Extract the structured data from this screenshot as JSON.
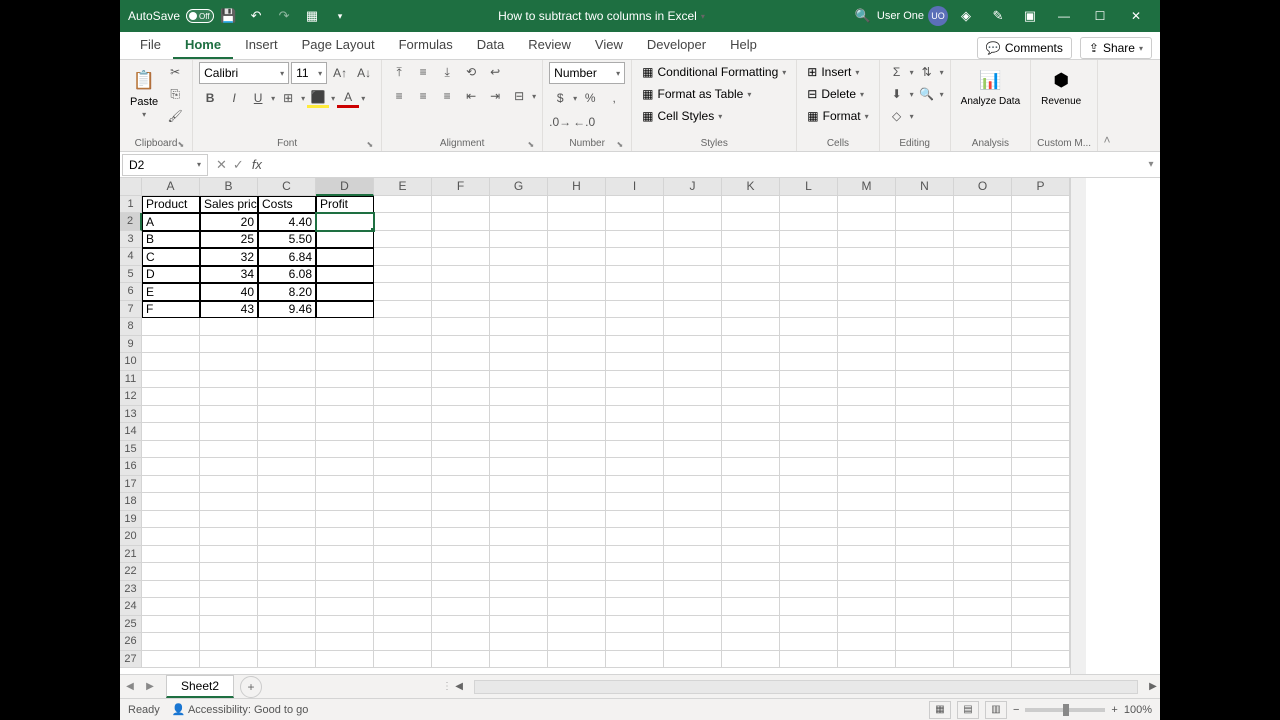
{
  "titlebar": {
    "autosave_label": "AutoSave",
    "autosave_state": "Off",
    "doc_title": "How to subtract two columns in Excel",
    "user_name": "User One",
    "user_initials": "UO"
  },
  "tabs": [
    "File",
    "Home",
    "Insert",
    "Page Layout",
    "Formulas",
    "Data",
    "Review",
    "View",
    "Developer",
    "Help"
  ],
  "active_tab": "Home",
  "ribbon_right": {
    "comments": "Comments",
    "share": "Share"
  },
  "ribbon": {
    "clipboard": {
      "paste": "Paste",
      "label": "Clipboard"
    },
    "font": {
      "name": "Calibri",
      "size": "11",
      "label": "Font"
    },
    "alignment": {
      "label": "Alignment"
    },
    "number": {
      "format": "Number",
      "label": "Number"
    },
    "styles": {
      "conditional": "Conditional Formatting",
      "table": "Format as Table",
      "cell": "Cell Styles",
      "label": "Styles"
    },
    "cells": {
      "insert": "Insert",
      "delete": "Delete",
      "format": "Format",
      "label": "Cells"
    },
    "editing": {
      "label": "Editing"
    },
    "analyze": {
      "label": "Analysis",
      "btn": "Analyze Data"
    },
    "revenue": {
      "label": "Custom M...",
      "btn": "Revenue"
    }
  },
  "name_box": "D2",
  "formula_bar": "",
  "columns": [
    "A",
    "B",
    "C",
    "D",
    "E",
    "F",
    "G",
    "H",
    "I",
    "J",
    "K",
    "L",
    "M",
    "N",
    "O",
    "P"
  ],
  "selected_cell": {
    "row": 2,
    "col": 4
  },
  "chart_data": {
    "type": "table",
    "headers": [
      "Product",
      "Sales price",
      "Costs",
      "Profit"
    ],
    "rows": [
      {
        "product": "A",
        "sales": "20",
        "costs": "4.40",
        "profit": ""
      },
      {
        "product": "B",
        "sales": "25",
        "costs": "5.50",
        "profit": ""
      },
      {
        "product": "C",
        "sales": "32",
        "costs": "6.84",
        "profit": ""
      },
      {
        "product": "D",
        "sales": "34",
        "costs": "6.08",
        "profit": ""
      },
      {
        "product": "E",
        "sales": "40",
        "costs": "8.20",
        "profit": ""
      },
      {
        "product": "F",
        "sales": "43",
        "costs": "9.46",
        "profit": ""
      }
    ]
  },
  "sheet_tabs": {
    "active": "Sheet2"
  },
  "statusbar": {
    "ready": "Ready",
    "accessibility": "Accessibility: Good to go",
    "zoom": "100%"
  }
}
